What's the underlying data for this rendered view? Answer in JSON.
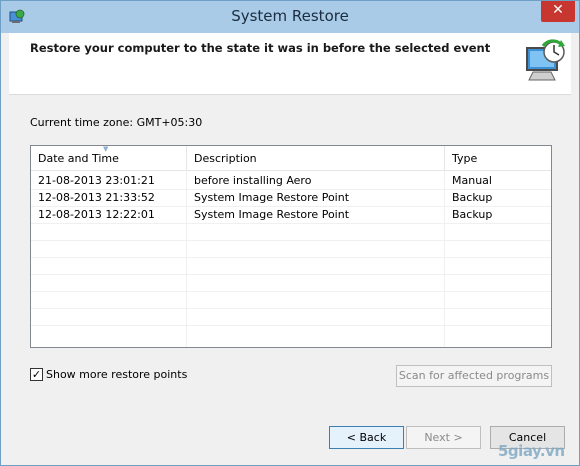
{
  "window": {
    "title": "System Restore"
  },
  "header": {
    "text": "Restore your computer to the state it was in before the selected event"
  },
  "timezone": "Current time zone: GMT+05:30",
  "list": {
    "columns": [
      "Date and Time",
      "Description",
      "Type"
    ],
    "rows": [
      {
        "date": "21-08-2013 23:01:21",
        "description": "before installing Aero",
        "type": "Manual"
      },
      {
        "date": "12-08-2013 21:33:52",
        "description": "System Image Restore Point",
        "type": "Backup"
      },
      {
        "date": "12-08-2013 12:22:01",
        "description": "System Image Restore Point",
        "type": "Backup"
      }
    ]
  },
  "show_more": {
    "label": "Show more restore points",
    "checked": true,
    "mark": "✓"
  },
  "scan_button": "Scan for affected programs",
  "buttons": {
    "back": "< Back",
    "next": "Next >",
    "cancel": "Cancel",
    "close": "✕"
  },
  "watermark": "5giay.vn"
}
